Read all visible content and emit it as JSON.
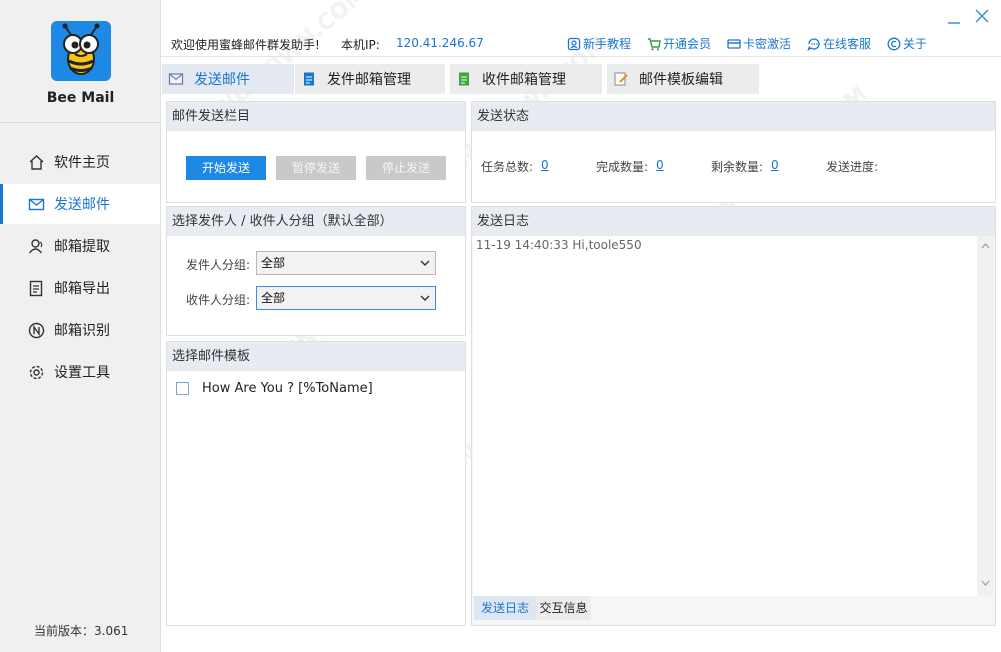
{
  "app": {
    "name": "Bee Mail",
    "version_label": "当前版本：3.061"
  },
  "sidebar": {
    "items": [
      {
        "label": "软件主页",
        "icon": "home-icon"
      },
      {
        "label": "发送邮件",
        "icon": "mail-icon",
        "active": true
      },
      {
        "label": "邮箱提取",
        "icon": "user-icon"
      },
      {
        "label": "邮箱导出",
        "icon": "export-icon"
      },
      {
        "label": "邮箱识别",
        "icon": "identify-icon"
      },
      {
        "label": "设置工具",
        "icon": "gear-icon"
      }
    ]
  },
  "header": {
    "welcome": "欢迎使用蜜蜂邮件群发助手!",
    "ip_label": "本机IP:",
    "ip_value": "120.41.246.67",
    "links": [
      {
        "label": "新手教程",
        "icon": "tutorial-icon"
      },
      {
        "label": "开通会员",
        "icon": "cart-icon"
      },
      {
        "label": "卡密激活",
        "icon": "card-icon"
      },
      {
        "label": "在线客服",
        "icon": "chat-icon"
      },
      {
        "label": "关于",
        "icon": "copyright-icon"
      }
    ]
  },
  "tabs": [
    {
      "label": "发送邮件",
      "icon": "mail-tab-icon",
      "active": true
    },
    {
      "label": "发件邮箱管理",
      "icon": "document-blue-icon"
    },
    {
      "label": "收件邮箱管理",
      "icon": "document-green-icon"
    },
    {
      "label": "邮件模板编辑",
      "icon": "edit-icon"
    }
  ],
  "send_panel": {
    "title": "邮件发送栏目",
    "start": "开始发送",
    "pause": "暂停发送",
    "stop": "停止发送"
  },
  "status_panel": {
    "title": "发送状态",
    "total_label": "任务总数:",
    "total_value": "0",
    "done_label": "完成数量:",
    "done_value": "0",
    "remaining_label": "剩余数量:",
    "remaining_value": "0",
    "progress_label": "发送进度:"
  },
  "group_panel": {
    "title": "选择发件人 / 收件人分组（默认全部）",
    "sender_label": "发件人分组:",
    "sender_value": "全部",
    "receiver_label": "收件人分组:",
    "receiver_value": "全部"
  },
  "template_panel": {
    "title": "选择邮件模板",
    "templates": [
      "How Are You ? [%ToName]"
    ]
  },
  "log_panel": {
    "title": "发送日志",
    "lines": [
      "11-19 14:40:33   Hi,toole550"
    ],
    "tabs": [
      "发送日志",
      "交互信息"
    ]
  },
  "colors": {
    "accent": "#1976d2",
    "primary_button": "#1e88e5",
    "disabled_button": "#c9c9c9",
    "panel_header": "#e8ebf2",
    "sidebar_bg": "#f0f0f0",
    "logo_bg": "#1e88e5"
  }
}
